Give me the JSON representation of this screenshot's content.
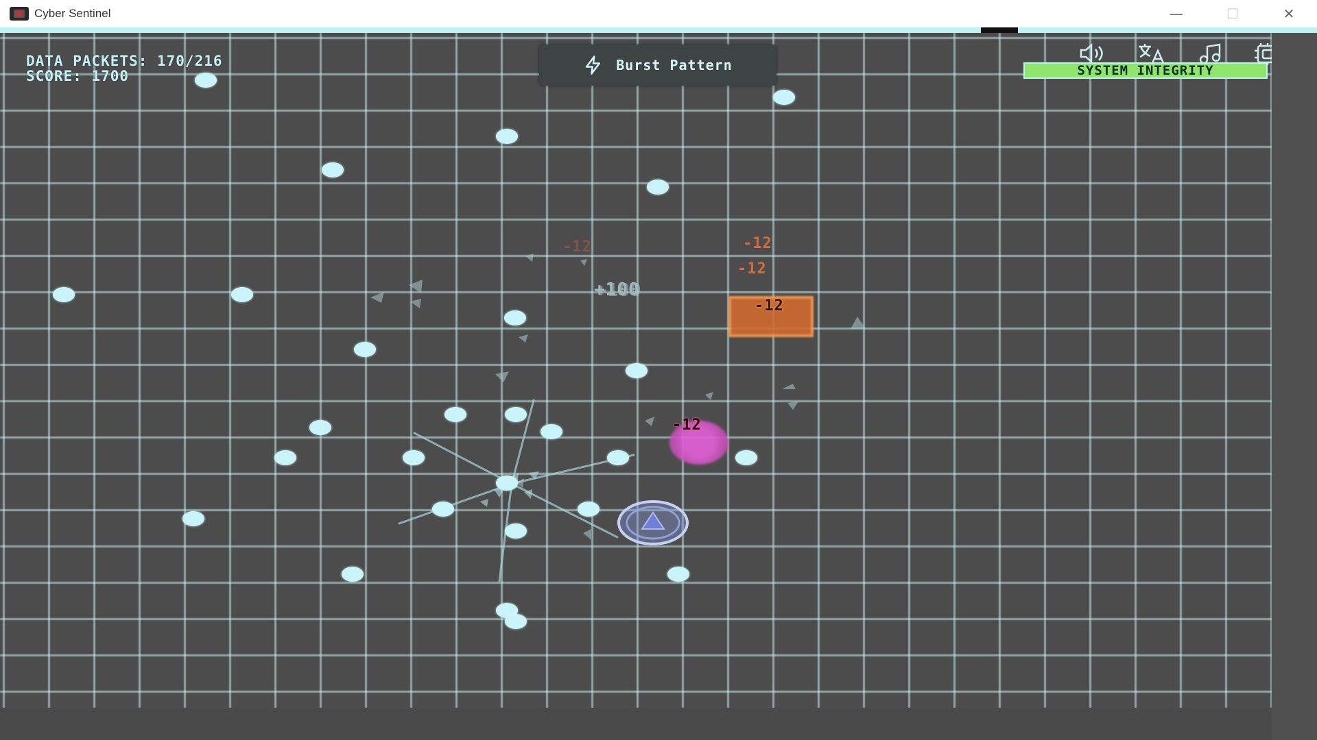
{
  "window": {
    "title": "Cyber Sentinel",
    "minimize_glyph": "—",
    "maximize_glyph": "☐",
    "close_glyph": "✕"
  },
  "hud": {
    "packets_label": "DATA PACKETS: 170/216",
    "score_label": "SCORE: 1700",
    "pattern": {
      "icon": "lightning-icon",
      "label": "Burst Pattern"
    },
    "integrity": {
      "label": "SYSTEM INTEGRITY",
      "level": 1.0,
      "color": "#8fe46a"
    },
    "icons": [
      "volume-icon",
      "translate-icon",
      "music-icon",
      "settings-icon"
    ]
  },
  "floating_text": {
    "score_popup": "+100",
    "damage": [
      {
        "text": "-12",
        "style": "faded"
      },
      {
        "text": "-12",
        "style": "normal"
      },
      {
        "text": "-12",
        "style": "normal"
      },
      {
        "text": "-12",
        "style": "normal"
      },
      {
        "text": "-12",
        "style": "pink"
      }
    ]
  },
  "colors": {
    "background": "#4c4c4c",
    "grid": "#c8f0f0",
    "packet": "#c9f5fa",
    "enemy_square": "#d06a30",
    "enemy_circle": "#e45fd8",
    "player": "#7f8fe0",
    "hud_text": "#c8f0f4"
  }
}
